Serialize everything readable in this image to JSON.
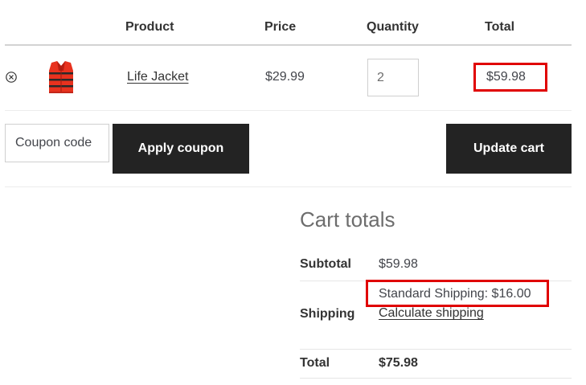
{
  "table": {
    "headers": {
      "product": "Product",
      "price": "Price",
      "quantity": "Quantity",
      "total": "Total"
    },
    "rows": [
      {
        "remove_icon": "remove-circle-icon",
        "thumbnail": "life-jacket-thumbnail",
        "product": "Life Jacket",
        "price": "$29.99",
        "quantity": "2",
        "total": "$59.98"
      }
    ]
  },
  "actions": {
    "coupon_placeholder": "Coupon code",
    "apply_label": "Apply coupon",
    "update_label": "Update cart"
  },
  "cart_totals": {
    "title": "Cart totals",
    "subtotal_label": "Subtotal",
    "subtotal_value": "$59.98",
    "shipping_label": "Shipping",
    "shipping_value": "Standard Shipping: $16.00",
    "calculate_shipping": "Calculate shipping",
    "total_label": "Total",
    "total_value": "$75.98"
  },
  "colors": {
    "highlight": "#e00000",
    "button_bg": "#232323",
    "text": "#43454b"
  }
}
